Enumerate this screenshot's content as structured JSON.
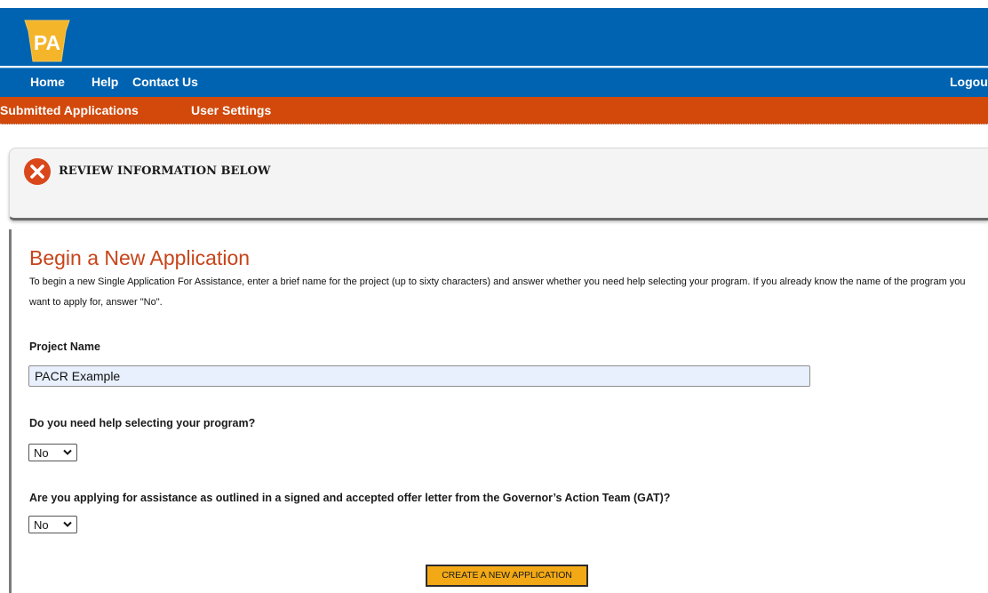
{
  "header": {
    "logo_text": "PA",
    "brand_color": "#0063b1"
  },
  "nav": {
    "home": "Home",
    "help": "Help",
    "contact_us": "Contact Us",
    "logout": "Logout"
  },
  "subnav": {
    "submitted_applications": "Submitted Applications",
    "user_settings": "User Settings",
    "color": "#d2490b"
  },
  "alert": {
    "icon": "close-circle-icon",
    "text": "REVIEW INFORMATION BELOW"
  },
  "main": {
    "title": "Begin a New Application",
    "intro": "To begin a new Single Application For Assistance, enter a brief name for the project (up to sixty characters) and answer whether you need help selecting your program. If you already know the name of the program you want to apply for, answer \"No\".",
    "project_name_label": "Project Name",
    "project_name_value": "PACR Example",
    "help_question": "Do you need help selecting your program?",
    "help_answer": "No",
    "gat_question": "Are you applying for assistance as outlined in a signed and accepted offer letter from the Governor’s Action Team (GAT)?",
    "gat_answer": "No",
    "create_button": "CREATE A NEW APPLICATION"
  }
}
